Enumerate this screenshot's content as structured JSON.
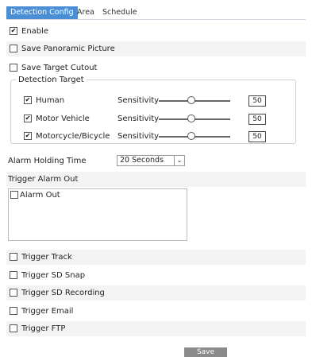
{
  "tabs": [
    {
      "label": "Detection Config"
    },
    {
      "label": "Area"
    },
    {
      "label": "Schedule"
    }
  ],
  "enable": {
    "label": "Enable",
    "checked": true
  },
  "save_panoramic": {
    "label": "Save Panoramic Picture",
    "checked": false
  },
  "save_target_cutout": {
    "label": "Save Target Cutout",
    "checked": false
  },
  "detection_target": {
    "legend": "Detection Target",
    "sensitivity_label": "Sensitivity",
    "items": [
      {
        "label": "Human",
        "checked": true,
        "sensitivity": "50"
      },
      {
        "label": "Motor Vehicle",
        "checked": true,
        "sensitivity": "50"
      },
      {
        "label": "Motorcycle/Bicycle",
        "checked": true,
        "sensitivity": "50"
      }
    ]
  },
  "alarm_holding": {
    "label": "Alarm Holding Time",
    "value": "20 Seconds"
  },
  "trigger_alarm_out": {
    "label": "Trigger Alarm Out",
    "option": "Alarm Out",
    "checked": false
  },
  "triggers": [
    {
      "label": "Trigger Track",
      "checked": false
    },
    {
      "label": "Trigger SD Snap",
      "checked": false
    },
    {
      "label": "Trigger SD Recording",
      "checked": false
    },
    {
      "label": "Trigger Email",
      "checked": false
    },
    {
      "label": "Trigger FTP",
      "checked": false
    }
  ],
  "save_button": "Save",
  "colors": {
    "tab_active": "#4a8fd6",
    "row_shade": "#f3f3f3",
    "save_button": "#8a8a8a"
  }
}
